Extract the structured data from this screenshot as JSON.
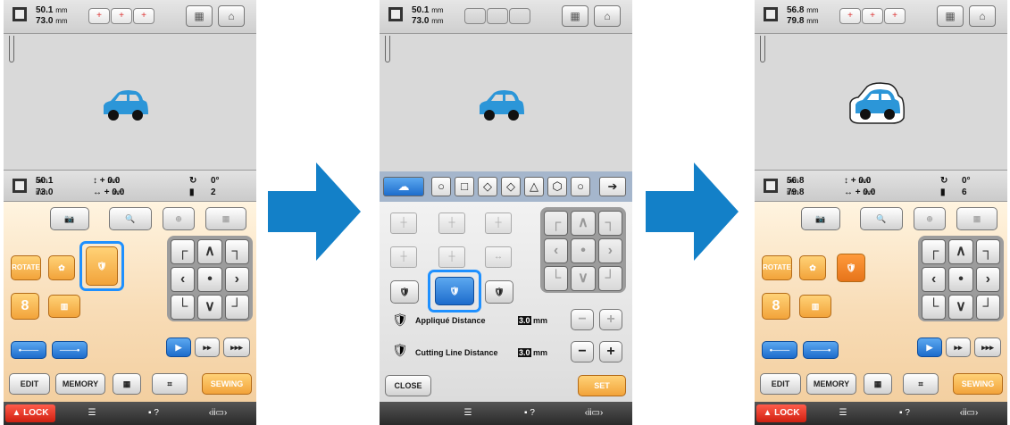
{
  "colors": {
    "accent_blue": "#1e90ff",
    "arrow_blue": "#1380c8",
    "orange": "#f2a33a",
    "lock_red": "#d01f10",
    "car_blue": "#2c96d8"
  },
  "screens": [
    {
      "top": {
        "width": "50.1",
        "height": "73.0",
        "unit": "mm"
      },
      "info": {
        "width": "50.1",
        "height": "73.0",
        "unit": "mm",
        "dy": "0.0",
        "dx": "0.0",
        "angle": "0°",
        "count": "2"
      },
      "buttons": {
        "rotate": "ROTATE",
        "edit": "EDIT",
        "memory": "MEMORY",
        "sewing": "SEWING",
        "lock": "LOCK"
      }
    },
    {
      "top": {
        "width": "50.1",
        "height": "73.0",
        "unit": "mm"
      },
      "applique_distance_label": "Appliqué Distance",
      "applique_distance_value": "3.0",
      "cutting_line_label": "Cutting Line Distance",
      "cutting_line_value": "3.0",
      "unit": "mm",
      "close": "CLOSE",
      "set": "SET"
    },
    {
      "top": {
        "width": "56.8",
        "height": "79.8",
        "unit": "mm"
      },
      "info": {
        "width": "56.8",
        "height": "79.8",
        "unit": "mm",
        "dy": "0.0",
        "dx": "0.0",
        "angle": "0°",
        "count": "6"
      },
      "buttons": {
        "rotate": "ROTATE",
        "edit": "EDIT",
        "memory": "MEMORY",
        "sewing": "SEWING",
        "lock": "LOCK"
      }
    }
  ]
}
